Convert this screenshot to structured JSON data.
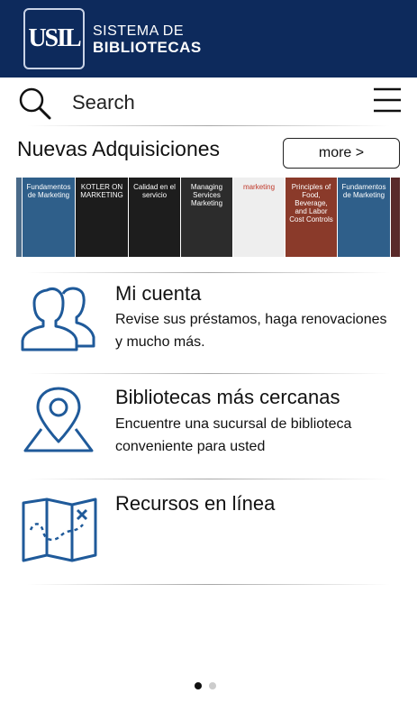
{
  "header": {
    "logo_text": "USIL",
    "brand_line1": "SISTEMA DE",
    "brand_line2": "BIBLIOTECAS",
    "background": "#0d2a5c"
  },
  "search": {
    "placeholder": "Search"
  },
  "new_acquisitions": {
    "title": "Nuevas Adquisiciones",
    "more_label": "more >",
    "books": [
      {
        "title": "",
        "color": "#4a6b8a"
      },
      {
        "title": "Fundamentos de Marketing",
        "color": "#2f5f8a"
      },
      {
        "title": "KOTLER ON MARKETING",
        "color": "#1c1c1c"
      },
      {
        "title": "Calidad en el servicio",
        "color": "#1d1d1d"
      },
      {
        "title": "Managing Services Marketing",
        "color": "#2c2c2c"
      },
      {
        "title": "marketing",
        "color": "#eeeeee"
      },
      {
        "title": "Principles of Food, Beverage, and Labor Cost Controls",
        "color": "#8a3a2a"
      },
      {
        "title": "Fundamentos de Marketing",
        "color": "#2f5f8a"
      },
      {
        "title": "",
        "color": "#5a2a2a"
      }
    ]
  },
  "menu": [
    {
      "title": "Mi cuenta",
      "description": "Revise sus préstamos, haga renovaciones y mucho más.",
      "icon": "users-icon"
    },
    {
      "title": "Bibliotecas más cercanas",
      "description": "Encuentre una sucursal de biblioteca conveniente para usted",
      "icon": "map-pin-icon"
    },
    {
      "title": "Recursos en línea",
      "description": "",
      "icon": "treasure-map-icon"
    }
  ],
  "pager": {
    "pages": 2,
    "current": 1
  },
  "colors": {
    "accent": "#1f5a9a",
    "active_dot": "#111111",
    "inactive_dot": "#cccccc"
  }
}
